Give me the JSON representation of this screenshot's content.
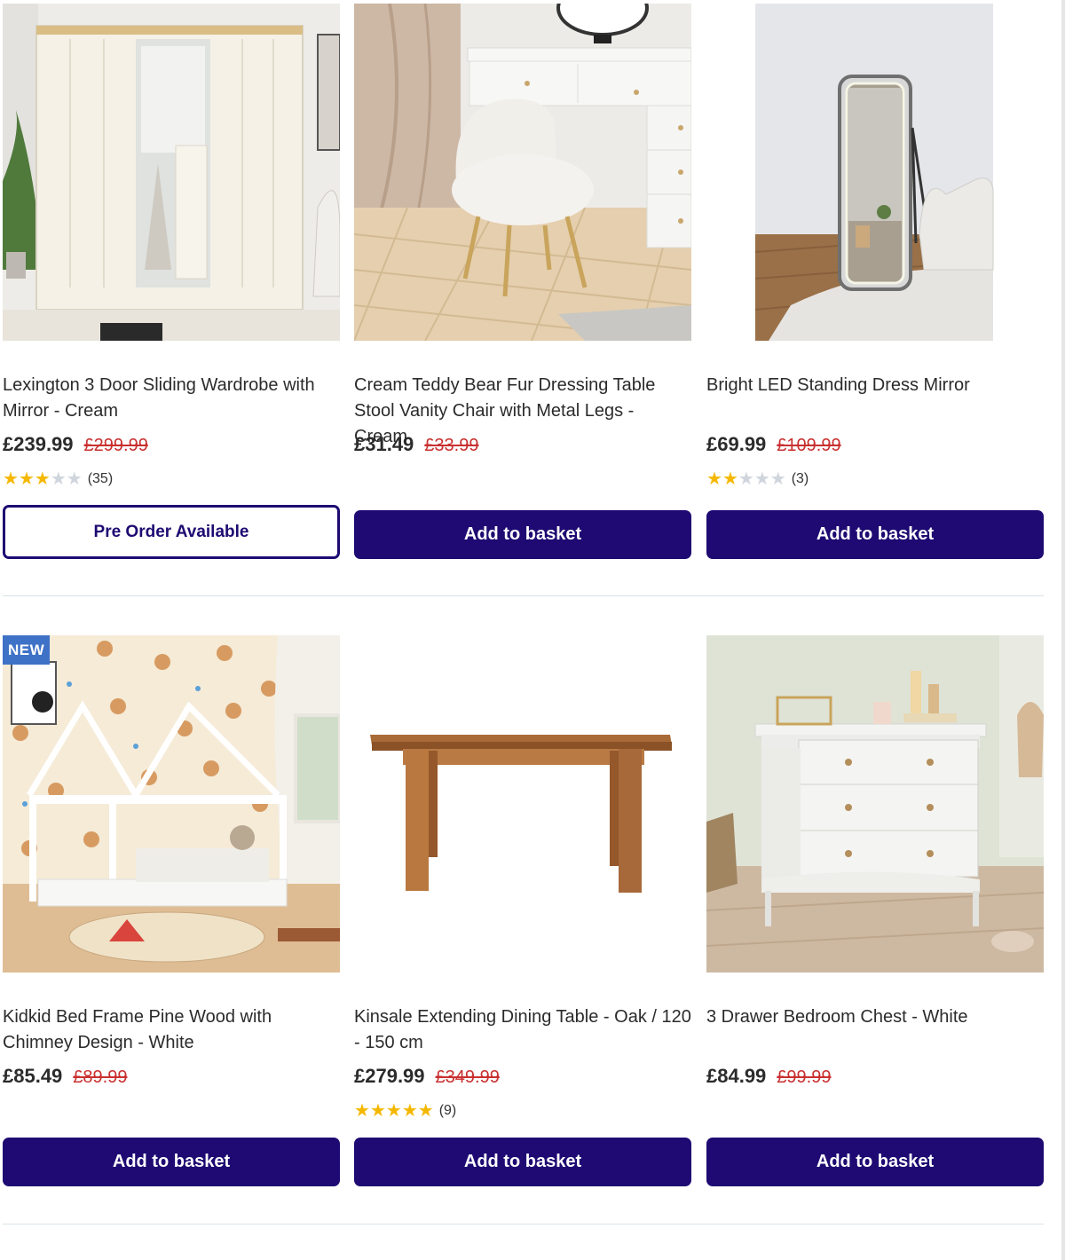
{
  "products": [
    {
      "name": "Lexington 3 Door Sliding Wardrobe with Mirror - Cream",
      "price": "£239.99",
      "was_price": "£299.99",
      "rating": 3,
      "rating_max": 5,
      "review_count": "(35)",
      "button_label": "Pre Order Available",
      "button_style": "outline",
      "image_icon": "wardrobe-image"
    },
    {
      "name": "Cream Teddy Bear Fur Dressing Table Stool Vanity Chair with Metal Legs - Cream",
      "price": "£31.49",
      "was_price": "£33.99",
      "button_label": "Add to basket",
      "button_style": "primary",
      "image_icon": "stool-image"
    },
    {
      "name": "Bright LED Standing Dress Mirror",
      "price": "£69.99",
      "was_price": "£109.99",
      "rating": 2,
      "rating_max": 5,
      "review_count": "(3)",
      "button_label": "Add to basket",
      "button_style": "primary",
      "image_icon": "mirror-image"
    },
    {
      "badge": "NEW",
      "name": "Kidkid Bed Frame Pine Wood with Chimney Design - White",
      "price": "£85.49",
      "was_price": "£89.99",
      "button_label": "Add to basket",
      "button_style": "primary",
      "image_icon": "bed-frame-image"
    },
    {
      "name": "Kinsale Extending Dining Table - Oak / 120 - 150 cm",
      "price": "£279.99",
      "was_price": "£349.99",
      "rating": 5,
      "rating_max": 5,
      "review_count": "(9)",
      "button_label": "Add to basket",
      "button_style": "primary",
      "image_icon": "dining-table-image"
    },
    {
      "name": "3 Drawer Bedroom Chest - White",
      "price": "£84.99",
      "was_price": "£99.99",
      "button_label": "Add to basket",
      "button_style": "primary",
      "image_icon": "chest-of-drawers-image"
    }
  ],
  "colors": {
    "primary_button": "#1e0a72",
    "sale_price": "#c93030",
    "star_on": "#f5b800",
    "star_off": "#cfd5dc",
    "badge": "#3e72c7"
  }
}
